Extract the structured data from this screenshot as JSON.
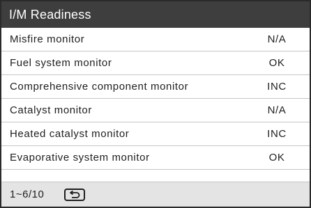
{
  "header": {
    "title": "I/M Readiness"
  },
  "monitors": [
    {
      "name": "Misfire monitor",
      "status": "N/A"
    },
    {
      "name": "Fuel system monitor",
      "status": "OK"
    },
    {
      "name": "Comprehensive component monitor",
      "status": "INC"
    },
    {
      "name": "Catalyst monitor",
      "status": "N/A"
    },
    {
      "name": "Heated catalyst monitor",
      "status": "INC"
    },
    {
      "name": "Evaporative system monitor",
      "status": "OK"
    }
  ],
  "footer": {
    "page_indicator": "1~6/10",
    "back_icon": "return-arrow-icon"
  },
  "colors": {
    "title_bar": "#3e3e3e",
    "footer_bar": "#e4e4e4",
    "divider": "#c6c6c6"
  }
}
